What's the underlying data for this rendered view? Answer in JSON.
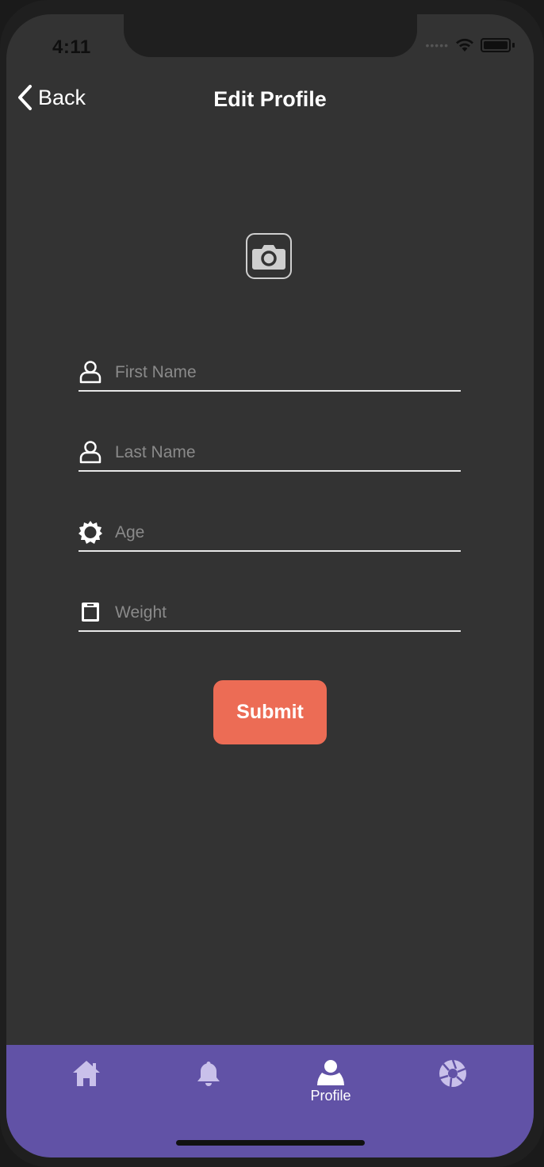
{
  "status": {
    "time": "4:11"
  },
  "nav": {
    "back_label": "Back",
    "title": "Edit Profile"
  },
  "form": {
    "first_name": {
      "placeholder": "First Name",
      "value": ""
    },
    "last_name": {
      "placeholder": "Last Name",
      "value": ""
    },
    "age": {
      "placeholder": "Age",
      "value": ""
    },
    "weight": {
      "placeholder": "Weight",
      "value": ""
    },
    "submit_label": "Submit"
  },
  "tabbar": {
    "items": [
      {
        "icon": "home-icon",
        "label": "",
        "active": false
      },
      {
        "icon": "bell-icon",
        "label": "",
        "active": false
      },
      {
        "icon": "user-icon",
        "label": "Profile",
        "active": true
      },
      {
        "icon": "aperture-icon",
        "label": "",
        "active": false
      }
    ]
  },
  "colors": {
    "background": "#333333",
    "accent": "#ec6c55",
    "tabbar": "#6152a6",
    "tab_icon_inactive": "#c9c0ea"
  }
}
